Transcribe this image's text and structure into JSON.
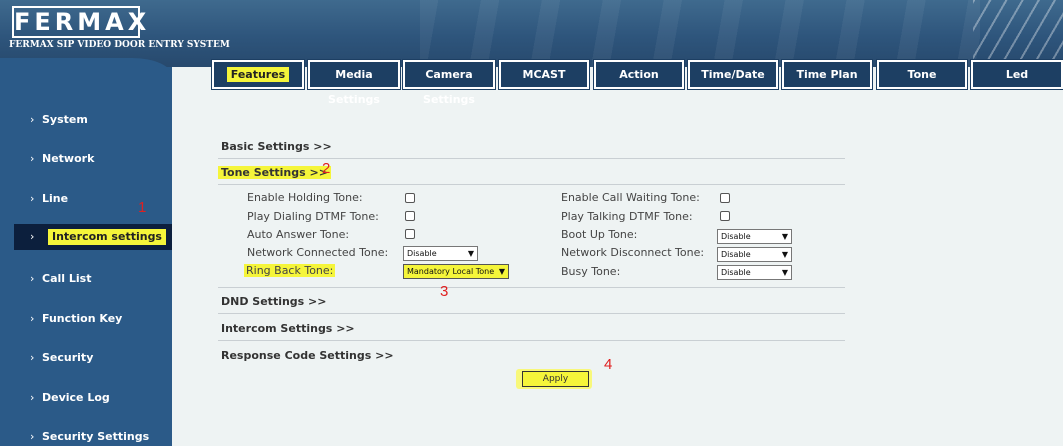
{
  "header": {
    "logo": "FERMAX",
    "subtitle": "FERMAX SIP VIDEO DOOR ENTRY SYSTEM"
  },
  "sidebar": {
    "items": [
      {
        "label": "System"
      },
      {
        "label": "Network"
      },
      {
        "label": "Line"
      },
      {
        "label": "Intercom settings",
        "active": true
      },
      {
        "label": "Call List"
      },
      {
        "label": "Function Key"
      },
      {
        "label": "Security"
      },
      {
        "label": "Device Log"
      },
      {
        "label": "Security Settings"
      }
    ]
  },
  "tabs": [
    {
      "label": "Features",
      "active": true
    },
    {
      "label": "Media Settings"
    },
    {
      "label": "Camera Settings"
    },
    {
      "label": "MCAST"
    },
    {
      "label": "Action"
    },
    {
      "label": "Time/Date"
    },
    {
      "label": "Time Plan"
    },
    {
      "label": "Tone"
    },
    {
      "label": "Led"
    }
  ],
  "sections": {
    "basic": "Basic Settings >>",
    "tone": "Tone Settings >>",
    "dnd": "DND Settings >>",
    "intercom": "Intercom Settings >>",
    "response": "Response Code Settings >>"
  },
  "tone_settings": {
    "enable_holding_tone": {
      "label": "Enable Holding Tone:",
      "checked": false
    },
    "play_dialing_dtmf": {
      "label": "Play Dialing DTMF Tone:",
      "checked": false
    },
    "auto_answer_tone": {
      "label": "Auto Answer Tone:",
      "checked": false
    },
    "network_connected_tone": {
      "label": "Network Connected Tone:",
      "value": "Disable"
    },
    "ring_back_tone": {
      "label": "Ring Back Tone:",
      "value": "Mandatory Local Tone"
    },
    "enable_call_waiting_tone": {
      "label": "Enable Call Waiting Tone:",
      "checked": false
    },
    "play_talking_dtmf": {
      "label": "Play Talking DTMF Tone:",
      "checked": false
    },
    "boot_up_tone": {
      "label": "Boot Up Tone:",
      "value": "Disable"
    },
    "network_disconnect_tone": {
      "label": "Network Disconnect Tone:",
      "value": "Disable"
    },
    "busy_tone": {
      "label": "Busy Tone:",
      "value": "Disable"
    }
  },
  "apply_label": "Apply",
  "annotations": [
    "1",
    "2",
    "3",
    "4"
  ],
  "colors": {
    "header": "#2e557c",
    "sidebar": "#2b5a88",
    "active_item": "#0c1f3d",
    "tab": "#1d3f63",
    "highlight": "#f5f53a",
    "annotation": "#e02020"
  }
}
